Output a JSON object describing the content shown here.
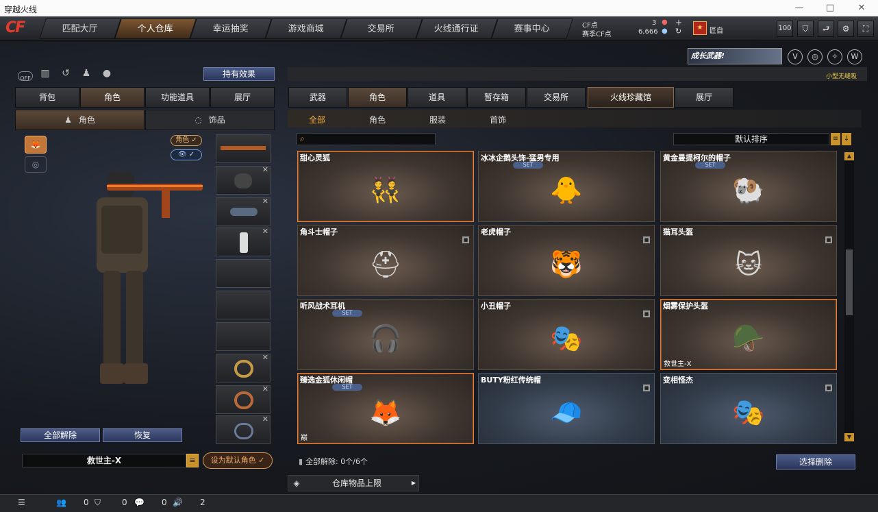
{
  "window": {
    "title": "穿越火线",
    "minimize": "—",
    "maximize": "□",
    "close": "✕"
  },
  "logo": "CF",
  "nav": {
    "tabs": [
      {
        "label": "匹配大厅",
        "active": false
      },
      {
        "label": "个人仓库",
        "active": true
      },
      {
        "label": "幸运抽奖",
        "active": false
      },
      {
        "label": "游戏商城",
        "active": false
      },
      {
        "label": "交易所",
        "active": false
      },
      {
        "label": "火线通行证",
        "active": false
      },
      {
        "label": "赛事中心",
        "active": false
      }
    ]
  },
  "currency": {
    "cf_label": "CF点",
    "cf_value": "3",
    "sc_label": "赛季CF点",
    "sc_value": "6,666",
    "plus": "+",
    "refresh": "↻"
  },
  "player": {
    "rank_icon": "rank-badge-icon",
    "rank_glyph": "★",
    "name": "匠自",
    "level": "100"
  },
  "toolbar_icons": [
    "helmet-icon",
    "back-icon",
    "settings-icon",
    "fullscreen-icon"
  ],
  "left": {
    "icons": [
      "toggle-off-icon",
      "stats-icon",
      "history-icon",
      "character-icon",
      "grenade-icon"
    ],
    "toggle_off_text": "OFF",
    "effect_button": "持有效果",
    "tabs": [
      {
        "label": "背包",
        "active": false
      },
      {
        "label": "角色",
        "active": true
      },
      {
        "label": "功能道具",
        "active": false
      },
      {
        "label": "展厅",
        "active": false
      }
    ],
    "subtabs": [
      {
        "label": "角色",
        "active": true
      },
      {
        "label": "饰品",
        "active": false
      }
    ],
    "toggle_role": "角色 ✓",
    "toggle_view": "👁 ✓",
    "unequip_all": "全部解除",
    "restore": "恢复",
    "char_name": "救世主-X",
    "menu_glyph": "≡",
    "set_default": "设为默认角色 ✓"
  },
  "right": {
    "banner": "成长武器!",
    "badges": [
      "V",
      "◎",
      "✧",
      "W"
    ],
    "promo": "小型无缝吸",
    "tabs": [
      {
        "label": "武器",
        "active": false
      },
      {
        "label": "角色",
        "active": true
      },
      {
        "label": "道具",
        "active": false
      },
      {
        "label": "暂存箱",
        "active": false
      },
      {
        "label": "交易所",
        "active": false
      },
      {
        "label": "火线珍藏馆",
        "special": true
      },
      {
        "label": "展厅",
        "active": false
      }
    ],
    "subtabs": [
      {
        "label": "全部",
        "active": true
      },
      {
        "label": "角色",
        "active": false
      },
      {
        "label": "服装",
        "active": false
      },
      {
        "label": "首饰",
        "active": false
      }
    ],
    "search_placeholder": "",
    "sort": "默认排序",
    "set_tag": "SET",
    "items": [
      {
        "name": "甜心灵狐",
        "set": false,
        "lock": false,
        "selected": true,
        "owner": "",
        "glyph": "👯"
      },
      {
        "name": "冰冰企鹅头饰-猛男专用",
        "set": true,
        "lock": false,
        "selected": false,
        "owner": "",
        "glyph": "🐥"
      },
      {
        "name": "黄金曼提柯尔的帽子",
        "set": true,
        "lock": false,
        "selected": false,
        "owner": "",
        "glyph": "🐏"
      },
      {
        "name": "角斗士帽子",
        "set": false,
        "lock": true,
        "selected": false,
        "owner": "",
        "glyph": "⛑"
      },
      {
        "name": "老虎帽子",
        "set": false,
        "lock": true,
        "selected": false,
        "owner": "",
        "glyph": "🐯"
      },
      {
        "name": "猫耳头盔",
        "set": false,
        "lock": true,
        "selected": false,
        "owner": "",
        "glyph": "🐱"
      },
      {
        "name": "听风战术耳机",
        "set": true,
        "lock": false,
        "selected": false,
        "owner": "",
        "glyph": "🎧"
      },
      {
        "name": "小丑帽子",
        "set": false,
        "lock": true,
        "selected": false,
        "owner": "",
        "glyph": "🎭"
      },
      {
        "name": "烟雾保护头盔",
        "set": false,
        "lock": false,
        "selected": true,
        "owner": "救世主-X",
        "glyph": "🪖"
      },
      {
        "name": "臻选金狐休闲帽",
        "set": true,
        "lock": false,
        "selected": true,
        "owner": "巅",
        "glyph": "🦊"
      },
      {
        "name": "BUTY粉红传统帽",
        "set": false,
        "lock": true,
        "selected": false,
        "owner": "",
        "glyph": "🧢",
        "blue": true
      },
      {
        "name": "变相怪杰",
        "set": false,
        "lock": true,
        "selected": false,
        "owner": "",
        "glyph": "🎭",
        "blue": true
      }
    ],
    "unequip_count": "全部解除: 0个/6个",
    "select_delete": "选择删除",
    "store_limit": "仓库物品上限"
  },
  "bottom": {
    "c1": "0",
    "c2": "0",
    "c3": "0",
    "c4": "2"
  },
  "colors": {
    "accent": "#e0803a",
    "gold": "#c9922a",
    "button_blue": "#3b4a73"
  }
}
